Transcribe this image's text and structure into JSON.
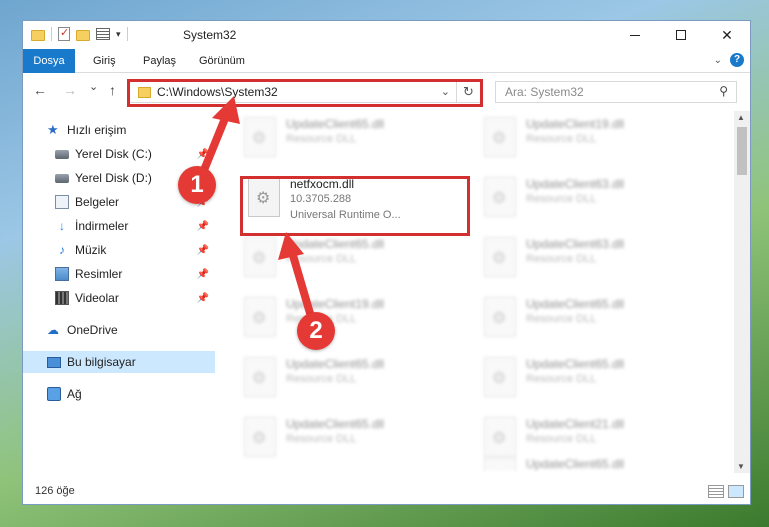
{
  "window": {
    "title": "System32",
    "minimize_glyph": "",
    "maximize_glyph": "",
    "close_glyph": "✕"
  },
  "ribbon": {
    "tabs": [
      "Dosya",
      "Giriş",
      "Paylaş",
      "Görünüm"
    ]
  },
  "nav": {
    "back": "←",
    "forward": "→",
    "recent": "⌄",
    "up": "↑",
    "address": "C:\\Windows\\System32",
    "refresh": "↻",
    "search_placeholder": "Ara: System32"
  },
  "sidebar": {
    "items": [
      {
        "label": "Hızlı erişim",
        "icon": "star-icon",
        "pinned": false
      },
      {
        "label": "Yerel Disk (C:)",
        "icon": "disk-icon",
        "pinned": true
      },
      {
        "label": "Yerel Disk (D:)",
        "icon": "disk-icon",
        "pinned": true
      },
      {
        "label": "Belgeler",
        "icon": "documents-icon",
        "pinned": true
      },
      {
        "label": "İndirmeler",
        "icon": "downloads-icon",
        "pinned": true
      },
      {
        "label": "Müzik",
        "icon": "music-icon",
        "pinned": true
      },
      {
        "label": "Resimler",
        "icon": "pictures-icon",
        "pinned": true
      },
      {
        "label": "Videolar",
        "icon": "videos-icon",
        "pinned": true
      },
      {
        "label": "OneDrive",
        "icon": "onedrive-icon",
        "pinned": false
      },
      {
        "label": "Bu bilgisayar",
        "icon": "this-pc-icon",
        "pinned": false,
        "selected": true
      },
      {
        "label": "Ağ",
        "icon": "network-icon",
        "pinned": false
      }
    ]
  },
  "files": {
    "selected": {
      "name": "netfxocm.dll",
      "version": "10.3705.288",
      "description": "Universal Runtime O..."
    },
    "left_column": [
      {
        "name": "UpdateClient65.dll",
        "type": "Resource DLL"
      },
      {
        "name": "UpdateClient65.dll",
        "type": "Resource DLL"
      },
      {
        "name": "UpdateClient19.dll",
        "type": "Resource DLL"
      },
      {
        "name": "UpdateClient65.dll",
        "type": "Resource DLL"
      },
      {
        "name": "UpdateClient65.dll",
        "type": "Resource DLL"
      }
    ],
    "right_column": [
      {
        "name": "UpdateClient19.dll",
        "type": "Resource DLL"
      },
      {
        "name": "UpdateClient63.dll",
        "type": "Resource DLL"
      },
      {
        "name": "UpdateClient63.dll",
        "type": "Resource DLL"
      },
      {
        "name": "UpdateClient65.dll",
        "type": "Resource DLL"
      },
      {
        "name": "UpdateClient65.dll",
        "type": "Resource DLL"
      },
      {
        "name": "UpdateClient21.dll",
        "type": "Resource DLL"
      },
      {
        "name": "UpdateClient65.dll",
        "type": "Resource DLL"
      }
    ]
  },
  "status": {
    "item_count": "126 öğe"
  },
  "callouts": {
    "step1": "1",
    "step2": "2",
    "highlight_color": "#d32f2f",
    "badge_color": "#e53935"
  },
  "colors": {
    "accent": "#1979ca",
    "selected_bg": "#cce8ff"
  }
}
